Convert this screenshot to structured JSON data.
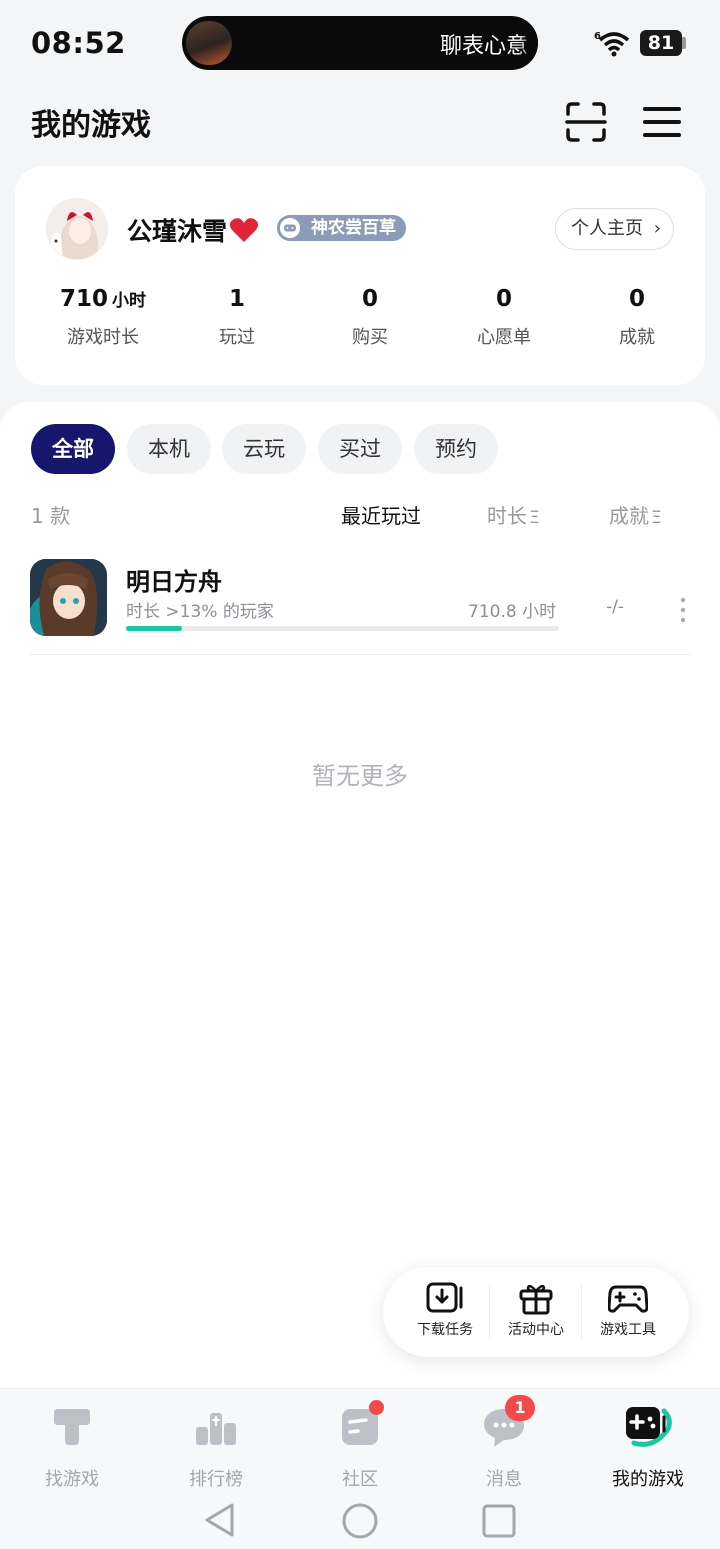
{
  "status_bar": {
    "time": "08:52",
    "island_text": "聊表心意",
    "battery": "81"
  },
  "header": {
    "title": "我的游戏"
  },
  "profile": {
    "name": "公瑾沐雪",
    "badge": "神农尝百草",
    "home_button": "个人主页",
    "stats": [
      {
        "value": "710",
        "unit": "小时",
        "label": "游戏时长"
      },
      {
        "value": "1",
        "unit": "",
        "label": "玩过"
      },
      {
        "value": "0",
        "unit": "",
        "label": "购买"
      },
      {
        "value": "0",
        "unit": "",
        "label": "心愿单"
      },
      {
        "value": "0",
        "unit": "",
        "label": "成就"
      }
    ]
  },
  "filters": {
    "chips": [
      "全部",
      "本机",
      "云玩",
      "买过",
      "预约"
    ],
    "active": "全部",
    "count": "1 款",
    "sort": [
      {
        "label": "最近玩过",
        "active": true
      },
      {
        "label": "时长",
        "active": false
      },
      {
        "label": "成就",
        "active": false
      }
    ]
  },
  "games": [
    {
      "name": "明日方舟",
      "subtitle": "时长 >13% 的玩家",
      "hours": "710.8 小时",
      "achievements": "-/-",
      "progress": 0.13
    }
  ],
  "empty_tip": "暂无更多",
  "tools": [
    "下载任务",
    "活动中心",
    "游戏工具"
  ],
  "bottom_nav": {
    "items": [
      "找游戏",
      "排行榜",
      "社区",
      "消息",
      "我的游戏"
    ],
    "active": "我的游戏",
    "message_badge": "1"
  },
  "colors": {
    "accent": "#15166c",
    "progress": "#19c7a0",
    "badge": "#f24a4a"
  }
}
